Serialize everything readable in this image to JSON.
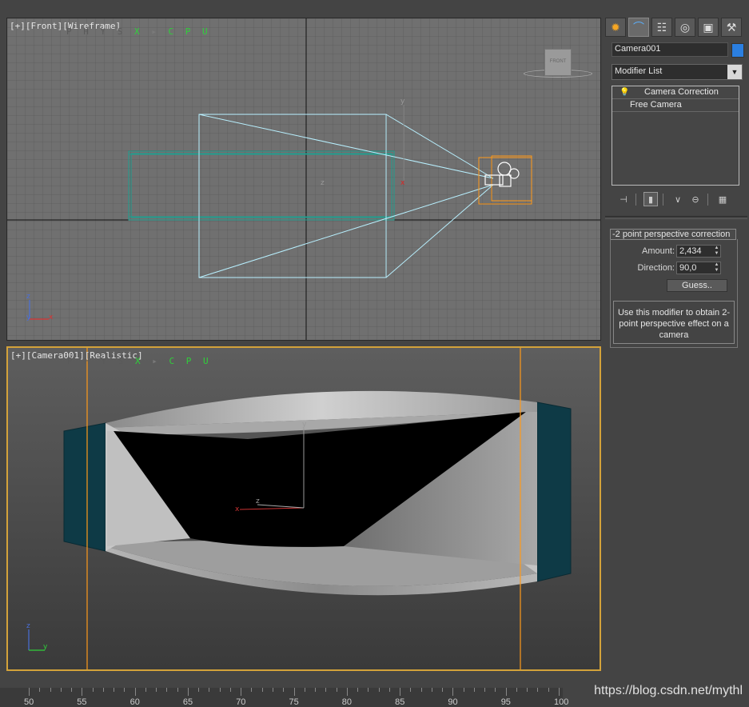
{
  "viewports": {
    "front": {
      "label_plus": "[+]",
      "label_view": "[Front]",
      "label_mode": "[Wireframe]",
      "physx_a": "P H Y S ",
      "physx_b": "X",
      "physx_c": " ▸ ",
      "physx_d": "C P U",
      "viewcube_text": "FRONT",
      "axis_y": "y",
      "axis_z": "z",
      "axis_x": "x",
      "gizmo_z": "z",
      "gizmo_x": "x",
      "gizmo_y": "y"
    },
    "camera": {
      "label_plus": "[+]",
      "label_view": "[Camera001]",
      "label_mode": "[Realistic]",
      "physx_a": "P H Y S ",
      "physx_b": "X",
      "physx_c": " ▸ ",
      "physx_d": "C P U",
      "axis_y": "y",
      "axis_z": "z",
      "axis_x": "x",
      "gizmo_z": "z",
      "gizmo_y": "y"
    }
  },
  "command_panel": {
    "tabs": [
      {
        "name": "create-tab",
        "icon": "sun-icon",
        "glyph": "✹"
      },
      {
        "name": "modify-tab",
        "icon": "modify-curve-icon",
        "glyph": "⌒"
      },
      {
        "name": "hierarchy-tab",
        "icon": "hierarchy-icon",
        "glyph": "☷"
      },
      {
        "name": "motion-tab",
        "icon": "motion-icon",
        "glyph": "◎"
      },
      {
        "name": "display-tab",
        "icon": "monitor-icon",
        "glyph": "▣"
      },
      {
        "name": "utilities-tab",
        "icon": "hammer-icon",
        "glyph": "⚒"
      }
    ],
    "object_name": "Camera001",
    "object_color": "#2b7fe0",
    "modifier_list": "Modifier List",
    "stack": [
      {
        "label": "Camera Correction"
      },
      {
        "label": "Free Camera"
      }
    ],
    "rollout": {
      "title": "-2 point perspective correction",
      "amount_label": "Amount:",
      "amount_value": "2,434",
      "direction_label": "Direction:",
      "direction_value": "90,0",
      "guess_label": "Guess..",
      "info": "Use this modifier to obtain 2-point perspective effect on a camera"
    }
  },
  "ruler": {
    "labels": [
      "50",
      "55",
      "60",
      "65",
      "70",
      "75",
      "80",
      "85",
      "90",
      "95",
      "100"
    ]
  },
  "watermark": "https://blog.csdn.net/mythl",
  "colors": {
    "wire_camera": "#b8f0ff",
    "wire_teal": "#1f9e8f",
    "selection_orange": "#ff9a1a",
    "physx_green": "#2fd03a",
    "active_border": "#d3a23a"
  }
}
